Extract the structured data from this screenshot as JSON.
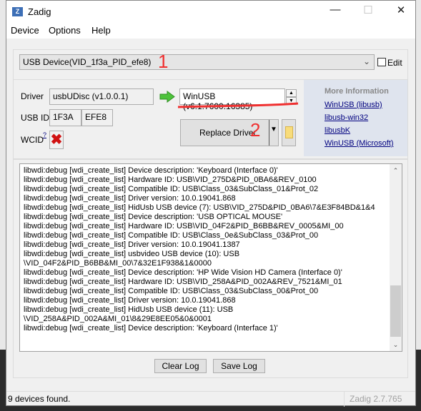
{
  "window": {
    "title": "Zadig",
    "app_icon": "Z",
    "controls": [
      "minimize",
      "maximize",
      "close"
    ]
  },
  "menu": [
    "Device",
    "Options",
    "Help"
  ],
  "device_select": {
    "value": "USB Device(VID_1f3a_PID_efe8)",
    "edit_label": "Edit",
    "edit_checked": false
  },
  "driver": {
    "label": "Driver",
    "current": "usbUDisc (v1.0.0.1)",
    "target": "WinUSB (v6.1.7600.16385)"
  },
  "usb_id": {
    "label": "USB ID",
    "vid": "1F3A",
    "pid": "EFE8"
  },
  "wcid": {
    "label": "WCID",
    "help": "?",
    "status_icon": "red-x-icon"
  },
  "replace_button": "Replace Driver",
  "more_info": {
    "title": "More Information",
    "links": [
      "WinUSB (libusb)",
      "libusb-win32",
      "libusbK",
      "WinUSB (Microsoft)"
    ]
  },
  "annotations": [
    "1",
    "2"
  ],
  "log_lines": [
    "libwdi:debug [wdi_create_list] Device description: 'Keyboard (Interface 0)'",
    "libwdi:debug [wdi_create_list] Hardware ID: USB\\VID_275D&PID_0BA6&REV_0100",
    "libwdi:debug [wdi_create_list] Compatible ID: USB\\Class_03&SubClass_01&Prot_02",
    "libwdi:debug [wdi_create_list] Driver version: 10.0.19041.868",
    "libwdi:debug [wdi_create_list] HidUsb USB device (7): USB\\VID_275D&PID_0BA6\\7&E3F84BD&1&4",
    "libwdi:debug [wdi_create_list] Device description: 'USB OPTICAL MOUSE'",
    "libwdi:debug [wdi_create_list] Hardware ID: USB\\VID_04F2&PID_B6BB&REV_0005&MI_00",
    "libwdi:debug [wdi_create_list] Compatible ID: USB\\Class_0e&SubClass_03&Prot_00",
    "libwdi:debug [wdi_create_list] Driver version: 10.0.19041.1387",
    "libwdi:debug [wdi_create_list] usbvideo USB device (10): USB",
    "\\VID_04F2&PID_B6BB&MI_00\\7&32E1F938&1&0000",
    "libwdi:debug [wdi_create_list] Device description: 'HP Wide Vision HD Camera (Interface 0)'",
    "libwdi:debug [wdi_create_list] Hardware ID: USB\\VID_258A&PID_002A&REV_7521&MI_01",
    "libwdi:debug [wdi_create_list] Compatible ID: USB\\Class_03&SubClass_00&Prot_00",
    "libwdi:debug [wdi_create_list] Driver version: 10.0.19041.868",
    "libwdi:debug [wdi_create_list] HidUsb USB device (11): USB",
    "\\VID_258A&PID_002A&MI_01\\8&29E8EE05&0&0001",
    "libwdi:debug [wdi_create_list] Device description: 'Keyboard (Interface 1)'"
  ],
  "buttons": {
    "clear_log": "Clear Log",
    "save_log": "Save Log"
  },
  "status": {
    "message": "9 devices found.",
    "version": "Zadig 2.7.765"
  }
}
